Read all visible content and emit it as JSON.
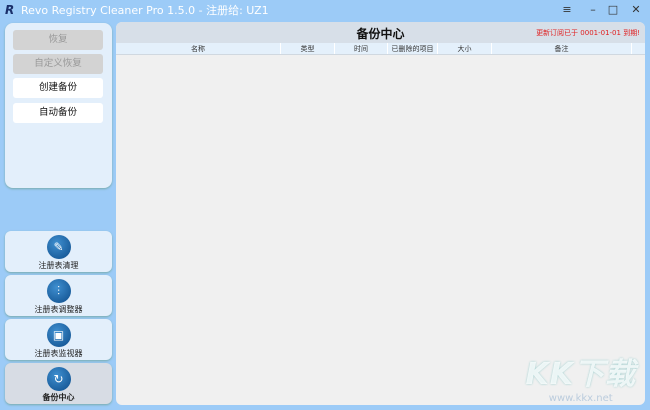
{
  "titlebar": {
    "title": "Revo Registry Cleaner Pro 1.5.0 - 注册给: UZ1",
    "menu": "≡",
    "minimize": "–",
    "maximize": "□",
    "close": "✕"
  },
  "left": {
    "buttons": [
      {
        "label": "恢复",
        "enabled": false
      },
      {
        "label": "自定义恢复",
        "enabled": false
      },
      {
        "label": "创建备份",
        "enabled": true
      },
      {
        "label": "自动备份",
        "enabled": true
      }
    ]
  },
  "nav": [
    {
      "label": "注册表清理",
      "icon": "broom-icon"
    },
    {
      "label": "注册表调整器",
      "icon": "sliders-icon"
    },
    {
      "label": "注册表监视器",
      "icon": "monitor-icon"
    },
    {
      "label": "备份中心",
      "icon": "backup-icon",
      "active": true
    }
  ],
  "main": {
    "title": "备份中心",
    "notice": "更新订阅已于 0001-01-01 到期!",
    "columns": [
      "名称",
      "类型",
      "时间",
      "已删除的项目",
      "大小",
      "备注"
    ]
  },
  "watermark": {
    "logo": "KK下载",
    "url": "www.kkx.net"
  }
}
